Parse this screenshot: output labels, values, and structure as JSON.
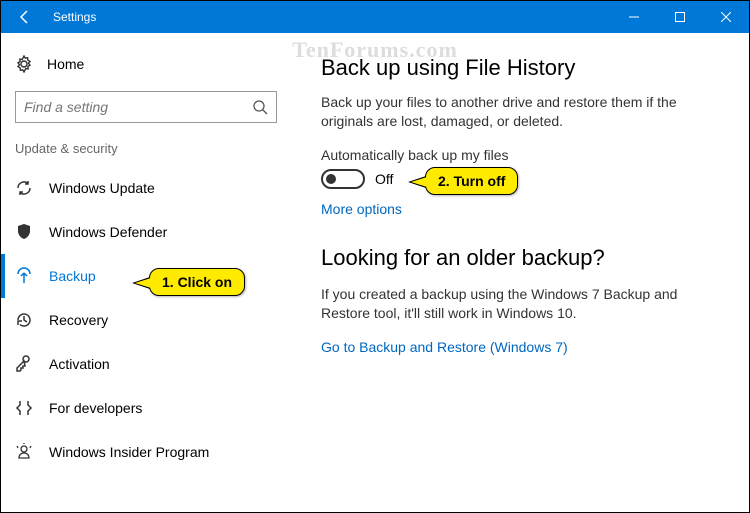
{
  "titlebar": {
    "title": "Settings"
  },
  "watermark": "TenForums.com",
  "sidebar": {
    "home": "Home",
    "search_placeholder": "Find a setting",
    "group": "Update & security",
    "items": [
      {
        "label": "Windows Update"
      },
      {
        "label": "Windows Defender"
      },
      {
        "label": "Backup"
      },
      {
        "label": "Recovery"
      },
      {
        "label": "Activation"
      },
      {
        "label": "For developers"
      },
      {
        "label": "Windows Insider Program"
      }
    ]
  },
  "main": {
    "h1": "Back up using File History",
    "p1": "Back up your files to another drive and restore them if the originals are lost, damaged, or deleted.",
    "toggle_label": "Automatically back up my files",
    "toggle_state": "Off",
    "more": "More options",
    "h2": "Looking for an older backup?",
    "p2": "If you created a backup using the Windows 7 Backup and Restore tool, it'll still work in Windows 10.",
    "link2": "Go to Backup and Restore (Windows 7)"
  },
  "callouts": {
    "one": "1. Click on",
    "two": "2. Turn off"
  }
}
